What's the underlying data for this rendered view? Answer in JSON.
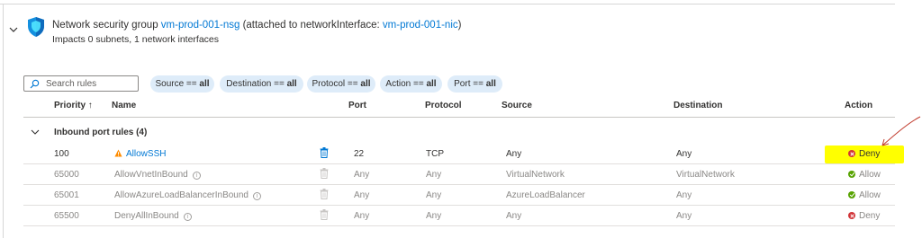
{
  "nsg": {
    "title_prefix": "Network security group ",
    "name": "vm-prod-001-nsg",
    "attached_prefix": " (attached to networkInterface: ",
    "nic": "vm-prod-001-nic",
    "attached_suffix": ")",
    "impacts": "Impacts 0 subnets, 1 network interfaces"
  },
  "search": {
    "placeholder": "Search rules"
  },
  "filters": [
    {
      "label": "Source ==",
      "value": "all"
    },
    {
      "label": "Destination ==",
      "value": "all"
    },
    {
      "label": "Protocol ==",
      "value": "all"
    },
    {
      "label": "Action ==",
      "value": "all"
    },
    {
      "label": "Port ==",
      "value": "all"
    }
  ],
  "columns": {
    "priority": "Priority ↑",
    "name": "Name",
    "port": "Port",
    "protocol": "Protocol",
    "source": "Source",
    "destination": "Destination",
    "action": "Action"
  },
  "group": {
    "label": "Inbound port rules (4)"
  },
  "rules": [
    {
      "priority": "100",
      "name": "AllowSSH",
      "port": "22",
      "protocol": "TCP",
      "source": "Any",
      "destination": "Any",
      "action": "Deny"
    },
    {
      "priority": "65000",
      "name": "AllowVnetInBound",
      "port": "Any",
      "protocol": "Any",
      "source": "VirtualNetwork",
      "destination": "VirtualNetwork",
      "action": "Allow"
    },
    {
      "priority": "65001",
      "name": "AllowAzureLoadBalancerInBound",
      "port": "Any",
      "protocol": "Any",
      "source": "AzureLoadBalancer",
      "destination": "Any",
      "action": "Allow"
    },
    {
      "priority": "65500",
      "name": "DenyAllInBound",
      "port": "Any",
      "protocol": "Any",
      "source": "Any",
      "destination": "Any",
      "action": "Deny"
    }
  ],
  "colors": {
    "link": "#0078d4",
    "deny": "#d13438",
    "allow": "#57a300",
    "highlight": "#ffff00",
    "annotation": "#c0392b",
    "pill": "#deecf9"
  }
}
